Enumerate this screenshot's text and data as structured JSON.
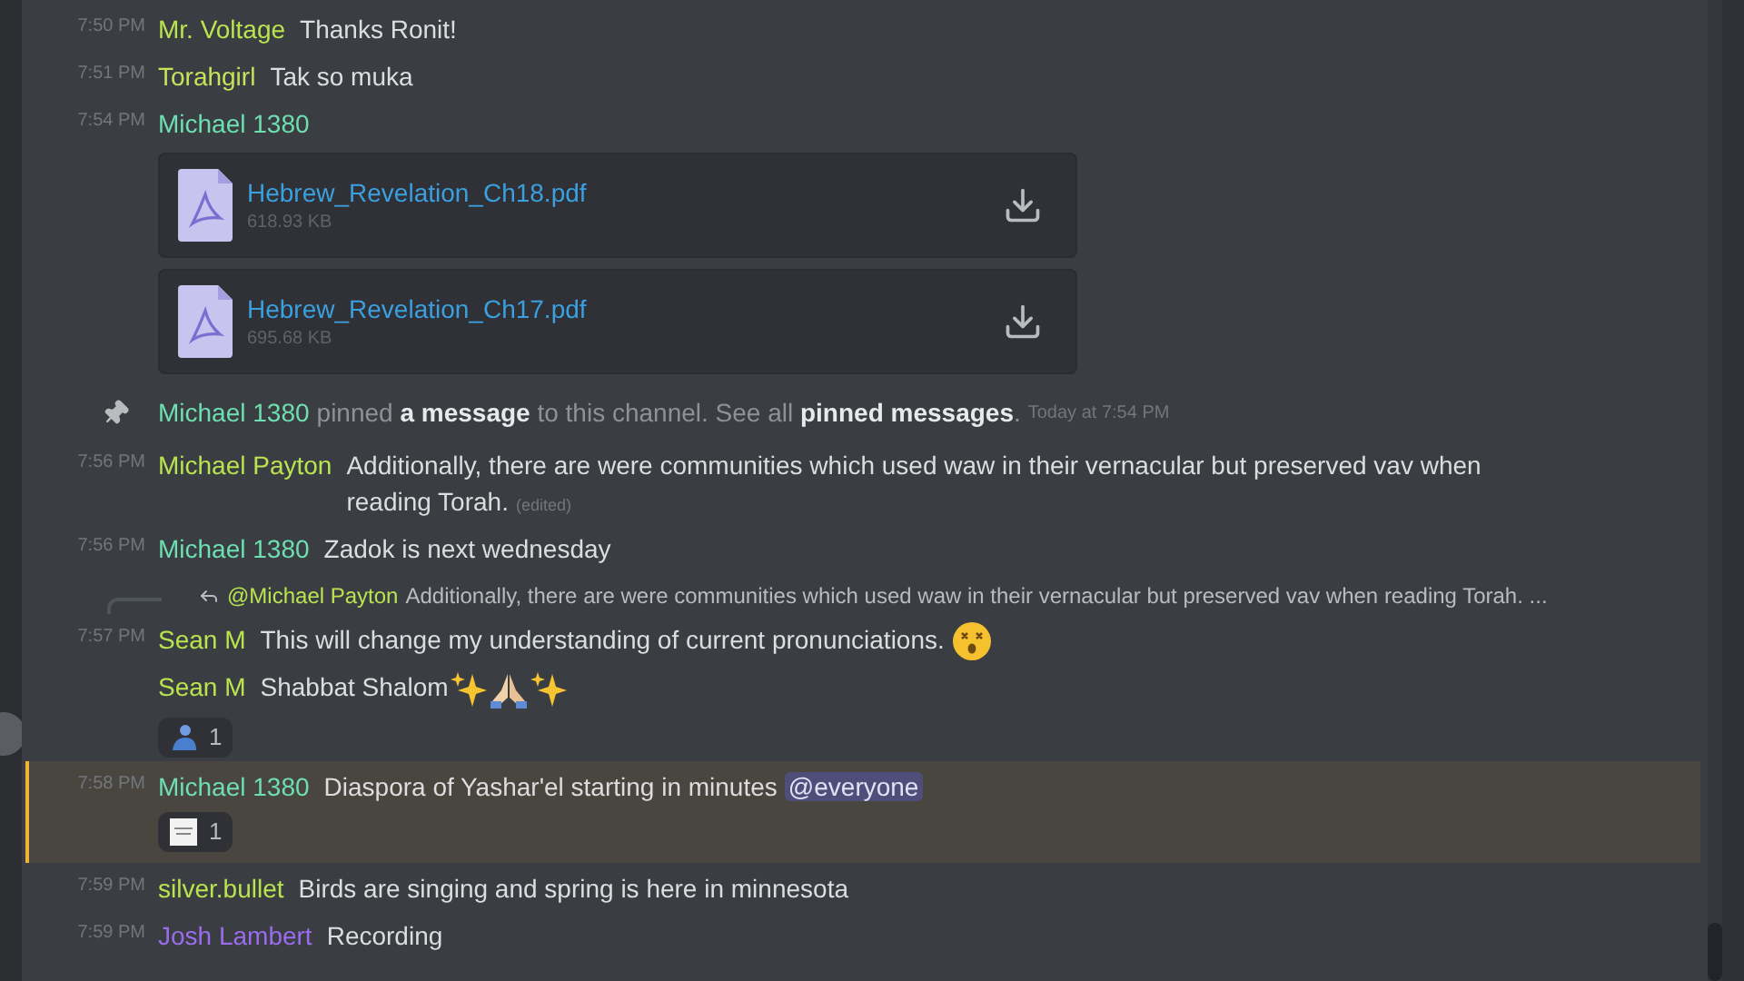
{
  "messages": [
    {
      "kind": "message",
      "time": "7:50 PM",
      "author": "Mr. Voltage",
      "color": "#b9e34f",
      "text": "Thanks Ronit!",
      "highlighted": false
    },
    {
      "kind": "message",
      "time": "7:51 PM",
      "author": "Torahgirl",
      "color": "#c6e35a",
      "text": "Tak so muka",
      "highlighted": false
    },
    {
      "kind": "message",
      "time": "7:54 PM",
      "author": "Michael 1380",
      "color": "#6ddfb0",
      "highlighted": false,
      "attachments": [
        {
          "name": "Hebrew_Revelation_Ch18.pdf",
          "size": "618.93 KB"
        },
        {
          "name": "Hebrew_Revelation_Ch17.pdf",
          "size": "695.68 KB"
        }
      ]
    },
    {
      "kind": "system",
      "author": "Michael 1380",
      "color": "#6ddfb0",
      "text": "pinned **a message** to this channel. See all **pinned messages**.",
      "time": "Today at 7:54 PM"
    },
    {
      "kind": "message",
      "time": "7:56 PM",
      "author": "Michael Payton",
      "color": "#b9e34f",
      "text": "Additionally, there are were communities which used waw in their vernacular but preserved vav when reading Torah.",
      "edited": "(edited)",
      "highlighted": false
    },
    {
      "kind": "message",
      "time": "7:56 PM",
      "author": "Michael 1380",
      "color": "#6ddfb0",
      "text": "Zadok is next wednesday",
      "highlighted": false
    },
    {
      "kind": "message",
      "time": "7:57 PM",
      "author": "Sean M",
      "color": "#b9e34f",
      "reply": {
        "author": "@Michael Payton",
        "text": "Additionally, there are were communities which used waw in their vernacular but preserved vav when reading Torah. ..."
      },
      "text": "This will change my understanding of current pronunciations.",
      "emojis": [
        {
          "kind": "dizzy"
        }
      ],
      "highlighted": false
    },
    {
      "kind": "message",
      "author": "Sean M",
      "color": "#b9e34f",
      "text": "Shabbat Shalom",
      "emojis": [
        {
          "kind": "sparkles"
        },
        {
          "kind": "pray"
        },
        {
          "kind": "sparkles"
        }
      ],
      "reactions": [
        {
          "kind": "person",
          "count": "1"
        }
      ],
      "highlighted": false
    },
    {
      "kind": "message",
      "time": "7:58 PM",
      "author": "Michael 1380",
      "color": "#6ddfb0",
      "text": "Diaspora of Yashar'el starting in minutes",
      "mention": "@everyone",
      "highlighted": true,
      "reactions": [
        {
          "kind": "sticker",
          "count": "1"
        }
      ]
    },
    {
      "kind": "message",
      "time": "7:59 PM",
      "author": "silver.bullet",
      "color": "#b9e34f",
      "text": "Birds are singing and spring is here in minnesota",
      "highlighted": false
    },
    {
      "kind": "message",
      "time": "7:59 PM",
      "author": "Josh Lambert",
      "color": "#9b6cf0",
      "text": "Recording",
      "highlighted": false
    }
  ]
}
